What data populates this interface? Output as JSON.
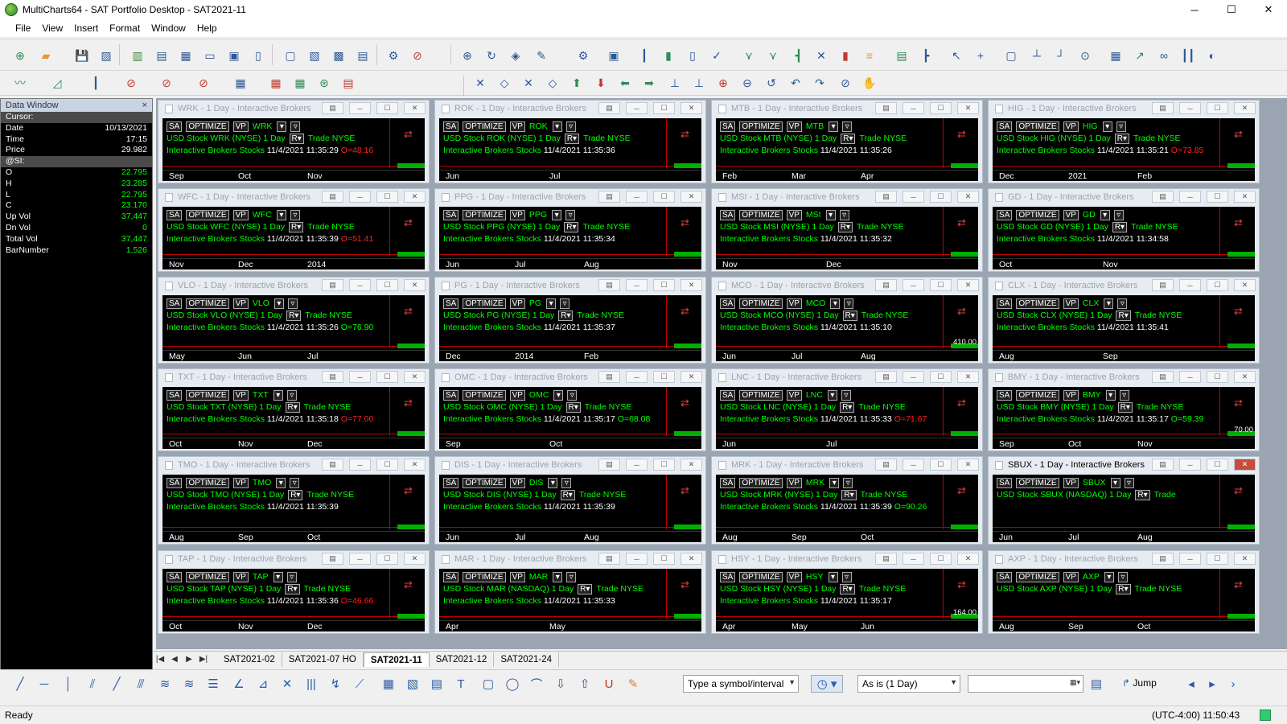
{
  "window": {
    "title": "MultiCharts64 - SAT Portfolio Desktop - SAT2021-11",
    "buttons": {
      "minimize": "─",
      "maximize": "☐",
      "close": "✕"
    }
  },
  "menu": [
    "File",
    "View",
    "Insert",
    "Format",
    "Window",
    "Help"
  ],
  "data_window": {
    "title": "Data Window",
    "close": "×",
    "rows": [
      {
        "label": "Cursor:",
        "value": "",
        "group": true
      },
      {
        "label": "Date",
        "value": "10/13/2021"
      },
      {
        "label": "Time",
        "value": "17:15"
      },
      {
        "label": "Price",
        "value": "29.982"
      },
      {
        "label": "@SI:",
        "value": "",
        "group": true
      },
      {
        "label": "O",
        "value": "22.795",
        "green": true
      },
      {
        "label": "H",
        "value": "23.285",
        "green": true
      },
      {
        "label": "L",
        "value": "22.795",
        "green": true
      },
      {
        "label": "C",
        "value": "23.170",
        "green": true
      },
      {
        "label": "Up Vol",
        "value": "37,447",
        "green": true
      },
      {
        "label": "Dn Vol",
        "value": "0",
        "green": true
      },
      {
        "label": "Total Vol",
        "value": "37,447",
        "green": true
      },
      {
        "label": "BarNumber",
        "value": "1,526",
        "green": true
      }
    ]
  },
  "chart_labels": {
    "sa": "SA",
    "optimize": "OPTIMIZE",
    "vp": "VP",
    "rv": "R▾",
    "provider": "Interactive Brokers",
    "stocks": "Stocks",
    "date": "11/4/2021",
    "trade": "Trade"
  },
  "charts": [
    {
      "title": "WRK - 1 Day - Interactive Brokers",
      "sym": "WRK",
      "desc": "USD Stock WRK (NYSE)",
      "interval": "1 Day",
      "exch": "NYSE",
      "time": "11:35:29",
      "extra": "O=48.16",
      "extra_red": true,
      "x": [
        "Sep",
        "Oct",
        "Nov"
      ]
    },
    {
      "title": "ROK - 1 Day - Interactive Brokers",
      "sym": "ROK",
      "desc": "USD Stock ROK (NYSE)",
      "interval": "1 Day",
      "exch": "NYSE",
      "time": "11:35:36",
      "extra": "",
      "x": [
        "Jun",
        "Jul"
      ]
    },
    {
      "title": "MTB - 1 Day - Interactive Brokers",
      "sym": "MTB",
      "desc": "USD Stock MTB (NYSE)",
      "interval": "1 Day",
      "exch": "NYSE",
      "time": "11:35:26",
      "extra": "",
      "x": [
        "Feb",
        "Mar",
        "Apr"
      ]
    },
    {
      "title": "HIG - 1 Day - Interactive Brokers",
      "sym": "HIG",
      "desc": "USD Stock HIG (NYSE)",
      "interval": "1 Day",
      "exch": "NYSE",
      "time": "11:35:21",
      "extra": "O=73.85",
      "extra_red": true,
      "x": [
        "Dec",
        "2021",
        "Feb"
      ]
    },
    {
      "title": "WFC - 1 Day - Interactive Brokers",
      "sym": "WFC",
      "desc": "USD Stock WFC (NYSE)",
      "interval": "1 Day",
      "exch": "NYSE",
      "time": "11:35:39",
      "extra": "O=51.41",
      "extra_red": true,
      "x": [
        "Nov",
        "Dec",
        "2014"
      ]
    },
    {
      "title": "PPG - 1 Day - Interactive Brokers",
      "sym": "PPG",
      "desc": "USD Stock PPG (NYSE)",
      "interval": "1 Day",
      "exch": "NYSE",
      "time": "11:35:34",
      "extra": "",
      "x": [
        "Jun",
        "Jul",
        "Aug"
      ]
    },
    {
      "title": "MSI - 1 Day - Interactive Brokers",
      "sym": "MSI",
      "desc": "USD Stock MSI (NYSE)",
      "interval": "1 Day",
      "exch": "NYSE",
      "time": "11:35:32",
      "extra": "",
      "x": [
        "Nov",
        "Dec"
      ]
    },
    {
      "title": "GD - 1 Day - Interactive Brokers",
      "sym": "GD",
      "desc": "USD Stock GD (NYSE)",
      "interval": "1 Day",
      "exch": "NYSE",
      "time": "11:34:58",
      "extra": "",
      "x": [
        "Oct",
        "Nov"
      ]
    },
    {
      "title": "VLO - 1 Day - Interactive Brokers",
      "sym": "VLO",
      "desc": "USD Stock VLO (NYSE)",
      "interval": "1 Day",
      "exch": "NYSE",
      "time": "11:35:26",
      "extra": "O=76.90",
      "extra_red": false,
      "x": [
        "May",
        "Jun",
        "Jul"
      ]
    },
    {
      "title": "PG - 1 Day - Interactive Brokers",
      "sym": "PG",
      "desc": "USD Stock PG (NYSE)",
      "interval": "1 Day",
      "exch": "NYSE",
      "time": "11:35:37",
      "extra": "",
      "x": [
        "Dec",
        "2014",
        "Feb"
      ]
    },
    {
      "title": "MCO - 1 Day - Interactive Brokers",
      "sym": "MCO",
      "desc": "USD Stock MCO (NYSE)",
      "interval": "1 Day",
      "exch": "NYSE",
      "time": "11:35:10",
      "extra": "",
      "x": [
        "Jun",
        "Jul",
        "Aug"
      ],
      "plabel": "410.00"
    },
    {
      "title": "CLX - 1 Day - Interactive Brokers",
      "sym": "CLX",
      "desc": "USD Stock CLX (NYSE)",
      "interval": "1 Day",
      "exch": "NYSE",
      "time": "11:35:41",
      "extra": "",
      "x": [
        "Aug",
        "Sep"
      ]
    },
    {
      "title": "TXT - 1 Day - Interactive Brokers",
      "sym": "TXT",
      "desc": "USD Stock TXT (NYSE)",
      "interval": "1 Day",
      "exch": "NYSE",
      "time": "11:35:18",
      "extra": "O=77.00",
      "extra_red": true,
      "x": [
        "Oct",
        "Nov",
        "Dec"
      ]
    },
    {
      "title": "OMC - 1 Day - Interactive Brokers",
      "sym": "OMC",
      "desc": "USD Stock OMC (NYSE)",
      "interval": "1 Day",
      "exch": "NYSE",
      "time": "11:35:17",
      "extra": "O=68.08",
      "extra_red": false,
      "x": [
        "Sep",
        "Oct"
      ]
    },
    {
      "title": "LNC - 1 Day - Interactive Brokers",
      "sym": "LNC",
      "desc": "USD Stock LNC (NYSE)",
      "interval": "1 Day",
      "exch": "NYSE",
      "time": "11:35:33",
      "extra": "O=71.67",
      "extra_red": true,
      "x": [
        "Jun",
        "Jul"
      ]
    },
    {
      "title": "BMY - 1 Day - Interactive Brokers",
      "sym": "BMY",
      "desc": "USD Stock BMY (NYSE)",
      "interval": "1 Day",
      "exch": "NYSE",
      "time": "11:35:17",
      "extra": "O=59.39",
      "extra_red": false,
      "x": [
        "Sep",
        "Oct",
        "Nov"
      ],
      "plabel": "70.00"
    },
    {
      "title": "TMO - 1 Day - Interactive Brokers",
      "sym": "TMO",
      "desc": "USD Stock TMO (NYSE)",
      "interval": "1 Day",
      "exch": "NYSE",
      "time": "11:35:39",
      "extra": "",
      "x": [
        "Aug",
        "Sep",
        "Oct"
      ]
    },
    {
      "title": "DIS - 1 Day - Interactive Brokers",
      "sym": "DIS",
      "desc": "USD Stock DIS (NYSE)",
      "interval": "1 Day",
      "exch": "NYSE",
      "time": "11:35:39",
      "extra": "",
      "x": [
        "Jun",
        "Jul",
        "Aug"
      ]
    },
    {
      "title": "MRK - 1 Day - Interactive Brokers",
      "sym": "MRK",
      "desc": "USD Stock MRK (NYSE)",
      "interval": "1 Day",
      "exch": "NYSE",
      "time": "11:35:39",
      "extra": "O=90.26",
      "extra_red": false,
      "x": [
        "Aug",
        "Sep",
        "Oct"
      ]
    },
    {
      "title": "SBUX - 1 Day - Interactive Brokers",
      "sym": "SBUX",
      "desc": "USD Stock SBUX (NASDAQ)",
      "interval": "1 Day",
      "exch": "",
      "time": "",
      "extra": "",
      "x": [
        "Jun",
        "Jul",
        "Aug"
      ],
      "active": true
    },
    {
      "title": "TAP - 1 Day - Interactive Brokers",
      "sym": "TAP",
      "desc": "USD Stock TAP (NYSE)",
      "interval": "1 Day",
      "exch": "NYSE",
      "time": "11:35:36",
      "extra": "O=46.66",
      "extra_red": true,
      "x": [
        "Oct",
        "Nov",
        "Dec"
      ]
    },
    {
      "title": "MAR - 1 Day - Interactive Brokers",
      "sym": "MAR",
      "desc": "USD Stock MAR (NASDAQ)",
      "interval": "1 Day",
      "exch": "NYSE",
      "time": "11:35:33",
      "extra": "",
      "x": [
        "Apr",
        "May"
      ]
    },
    {
      "title": "HSY - 1 Day - Interactive Brokers",
      "sym": "HSY",
      "desc": "USD Stock HSY (NYSE)",
      "interval": "1 Day",
      "exch": "NYSE",
      "time": "11:35:17",
      "extra": "",
      "x": [
        "Apr",
        "May",
        "Jun"
      ],
      "plabel": "164.00"
    },
    {
      "title": "AXP - 1 Day - Interactive Brokers",
      "sym": "AXP",
      "desc": "USD Stock AXP (NYSE)",
      "interval": "1 Day",
      "exch": "NYSE",
      "time": "",
      "extra": "",
      "x": [
        "Aug",
        "Sep",
        "Oct"
      ]
    }
  ],
  "tabs": [
    "SAT2021-02",
    "SAT2021-07 HO",
    "SAT2021-11",
    "SAT2021-12",
    "SAT2021-24"
  ],
  "active_tab": "SAT2021-11",
  "drawbar": {
    "symbol_placeholder": "Type a symbol/interval",
    "resolution": "As is (1 Day)",
    "jump": "Jump"
  },
  "status": {
    "left": "Ready",
    "clock": "(UTC-4:00) 11:50:43"
  },
  "colors": {
    "positive": "#00ff00",
    "negative": "#ff2020",
    "chart_bg": "#000000",
    "active_close": "#c84c3c"
  }
}
